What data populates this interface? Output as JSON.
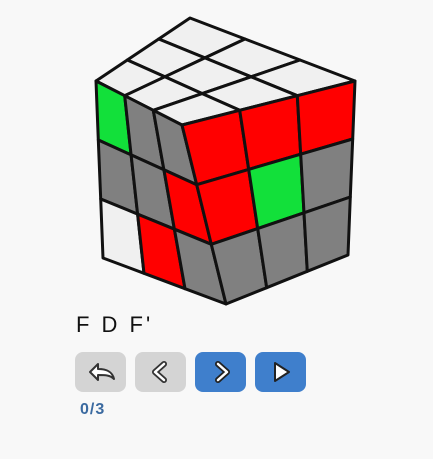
{
  "puzzle": {
    "type": "3x3 cube",
    "palette": {
      "W": "#f0f0f0",
      "G": "#12e03a",
      "R": "#ff0000",
      "X": "#808080"
    },
    "faces": {
      "top": [
        "W",
        "W",
        "W",
        "W",
        "W",
        "W",
        "W",
        "W",
        "W"
      ],
      "front": [
        "G",
        "X",
        "X",
        "X",
        "X",
        "R",
        "W",
        "R",
        "X"
      ],
      "right": [
        "R",
        "R",
        "R",
        "R",
        "G",
        "X",
        "X",
        "X",
        "X"
      ]
    }
  },
  "algorithm": {
    "moves": "F D F'"
  },
  "controls": {
    "reset_icon": "undo-icon",
    "prev_icon": "chevron-left-icon",
    "next_icon": "chevron-right-icon",
    "play_icon": "play-icon",
    "reset_color": "#d4d4d4",
    "prev_color": "#d4d4d4",
    "next_color": "#3f7fcc",
    "play_color": "#3f7fcc"
  },
  "progress": {
    "text": "0/3",
    "current": 0,
    "total": 3
  }
}
